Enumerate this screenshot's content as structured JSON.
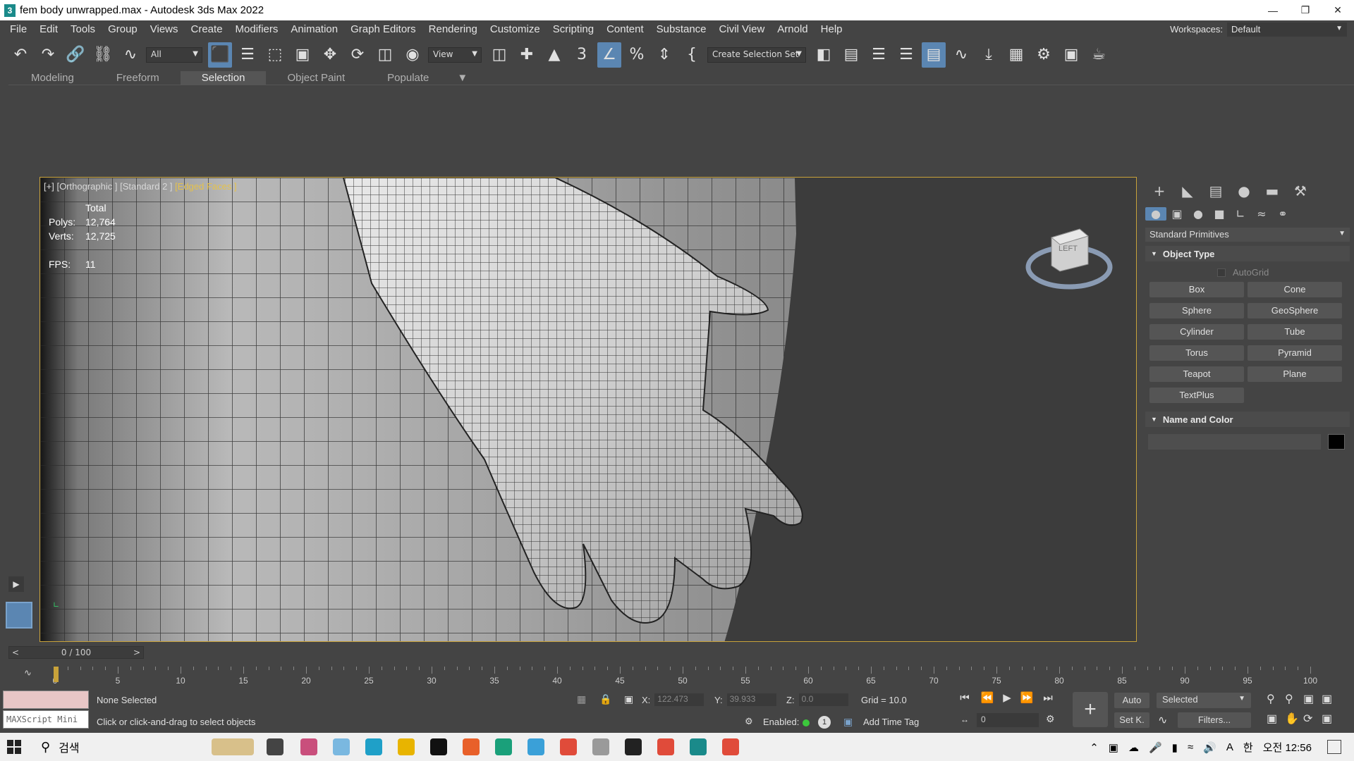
{
  "window": {
    "title": "fem body unwrapped.max - Autodesk 3ds Max 2022"
  },
  "menu": [
    "File",
    "Edit",
    "Tools",
    "Group",
    "Views",
    "Create",
    "Modifiers",
    "Animation",
    "Graph Editors",
    "Rendering",
    "Customize",
    "Scripting",
    "Content",
    "Substance",
    "Civil View",
    "Arnold",
    "Help"
  ],
  "workspaces": {
    "label": "Workspaces:",
    "value": "Default"
  },
  "toolbar": {
    "filter_value": "All",
    "ref_coord_value": "View",
    "selection_set_value": "Create Selection Set"
  },
  "ribbon": {
    "tabs": [
      "Modeling",
      "Freeform",
      "Selection",
      "Object Paint",
      "Populate"
    ],
    "active": "Selection"
  },
  "viewport": {
    "label_plus": "[+]",
    "label_view": "[Orthographic ]",
    "label_shading": "[Standard 2 ]",
    "label_edged": "[Edged Faces ]",
    "stats": {
      "total": "Total",
      "polys_label": "Polys:",
      "polys": "12,764",
      "verts_label": "Verts:",
      "verts": "12,725",
      "fps_label": "FPS:",
      "fps": "11"
    },
    "viewcube_face": "LEFT"
  },
  "command_panel": {
    "category": "Standard Primitives",
    "object_type_title": "Object Type",
    "autogrid": "AutoGrid",
    "buttons": [
      "Box",
      "Cone",
      "Sphere",
      "GeoSphere",
      "Cylinder",
      "Tube",
      "Torus",
      "Pyramid",
      "Teapot",
      "Plane",
      "TextPlus"
    ],
    "name_color_title": "Name and Color",
    "color": "#000000"
  },
  "timeline": {
    "slider": "0 / 100",
    "prev": "<",
    "next": ">",
    "ticks": [
      "0",
      "5",
      "10",
      "15",
      "20",
      "25",
      "30",
      "35",
      "40",
      "45",
      "50",
      "55",
      "60",
      "65",
      "70",
      "75",
      "80",
      "85",
      "90",
      "95",
      "100"
    ]
  },
  "status": {
    "maxscript": "MAXScript Mini",
    "selection": "None Selected",
    "hint": "Click or click-and-drag to select objects",
    "x_label": "X:",
    "x": "122.473",
    "y_label": "Y:",
    "y": "39.933",
    "z_label": "Z:",
    "z": "0.0",
    "grid": "Grid = 10.0",
    "enabled": "Enabled:",
    "add_time_tag": "Add Time Tag",
    "auto": "Auto",
    "selected": "Selected",
    "setk": "Set K.",
    "filters": "Filters...",
    "frame": "0"
  },
  "taskbar": {
    "search": "검색",
    "time": "오전 12:56",
    "ime": "한"
  }
}
